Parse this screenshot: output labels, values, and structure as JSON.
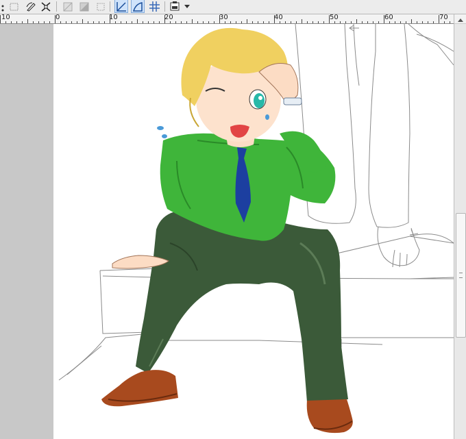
{
  "toolbar": {
    "icons": [
      "transform-icon",
      "select-rect-icon",
      "lasso-pen-icon",
      "pinch-icon",
      "invert-selection-icon",
      "fill-selection-icon",
      "clear-selection-icon",
      "guide-snap-icon",
      "ruler-snap-icon",
      "grid-icon",
      "display-mode-icon",
      "dropdown-arrow-icon"
    ]
  },
  "ruler": {
    "labels": [
      "10",
      "0",
      "10",
      "20",
      "30",
      "40",
      "50",
      "60",
      "70"
    ]
  },
  "canvas": {
    "background": "#ffffff",
    "illustration": "character-sitting-on-step"
  },
  "colors": {
    "shirt": "#3fb53a",
    "pants": "#3c5a3a",
    "tie": "#1c3fa0",
    "hair": "#f0d060",
    "shoes": "#a84a1e",
    "eye": "#27b8a8",
    "accent": "#4a86d0"
  }
}
